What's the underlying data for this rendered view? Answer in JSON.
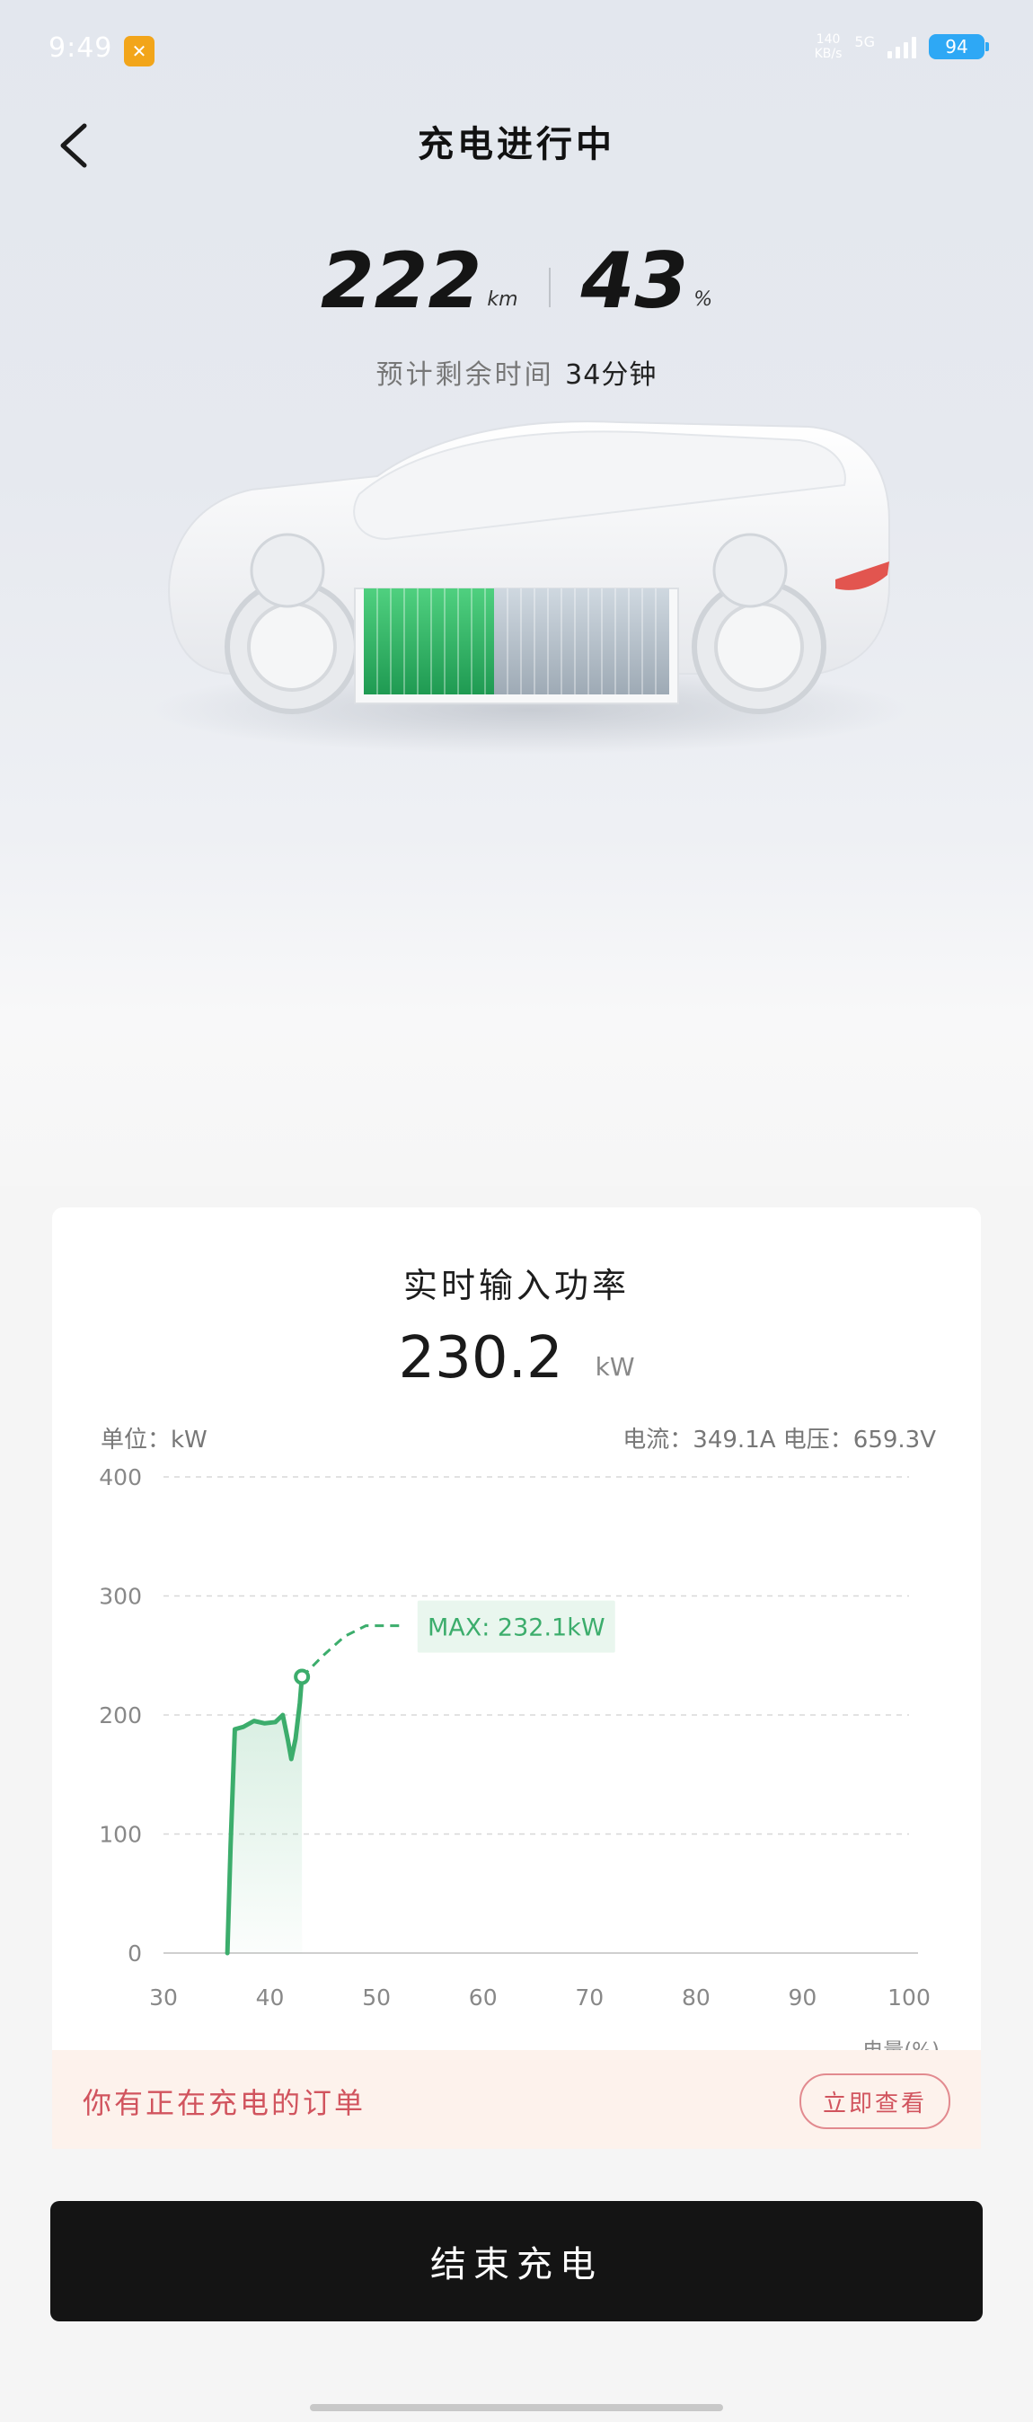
{
  "status_bar": {
    "time": "9:49",
    "net_speed_value": "140",
    "net_speed_unit": "KB/s",
    "network": "5G",
    "battery": "94"
  },
  "header": {
    "title": "充电进行中"
  },
  "summary": {
    "range_value": "222",
    "range_unit": "km",
    "percent_value": "43",
    "percent_unit": "%",
    "remaining_label": "预计剩余时间",
    "remaining_value": "34分钟"
  },
  "power_card": {
    "title": "实时输入功率",
    "power_value": "230.2",
    "power_unit": "kW",
    "unit_label": "单位：kW",
    "current_voltage": "电流：349.1A  电压：659.3V",
    "max_label": "MAX: 232.1kW"
  },
  "chart_data": {
    "type": "line",
    "xlabel": "电量(%)",
    "ylabel": "单位：kW",
    "xlim": [
      30,
      100
    ],
    "ylim": [
      0,
      400
    ],
    "x_ticks": [
      "30",
      "40",
      "50",
      "60",
      "70",
      "80",
      "90",
      "100"
    ],
    "y_ticks": [
      "0",
      "100",
      "200",
      "300",
      "400"
    ],
    "grid": true,
    "series": [
      {
        "points": [
          [
            36,
            0
          ],
          [
            36.3,
            90
          ],
          [
            36.7,
            188
          ],
          [
            37.5,
            190
          ],
          [
            38.5,
            195
          ],
          [
            39.5,
            193
          ],
          [
            40.5,
            194
          ],
          [
            41.2,
            200
          ],
          [
            41.7,
            178
          ],
          [
            42,
            163
          ],
          [
            42.4,
            180
          ],
          [
            42.8,
            210
          ],
          [
            43,
            232
          ]
        ],
        "color": "#3cad6c"
      }
    ],
    "projection": {
      "points": [
        [
          43,
          232
        ],
        [
          45,
          250
        ],
        [
          47,
          266
        ],
        [
          49,
          275
        ],
        [
          51,
          275
        ],
        [
          52.5,
          275
        ]
      ],
      "color": "#3cad6c"
    },
    "max_point": {
      "x": 43,
      "y": 232.1
    }
  },
  "order": {
    "text": "你有正在充电的订单",
    "button_label": "立即查看"
  },
  "actions": {
    "stop_label": "结束充电"
  },
  "colors": {
    "accent_green": "#3cad6c",
    "order_red": "#d1545e",
    "stop_button_bg": "#141414",
    "battery_blue": "#2ea8f5",
    "status_badge": "#f2a51a"
  }
}
